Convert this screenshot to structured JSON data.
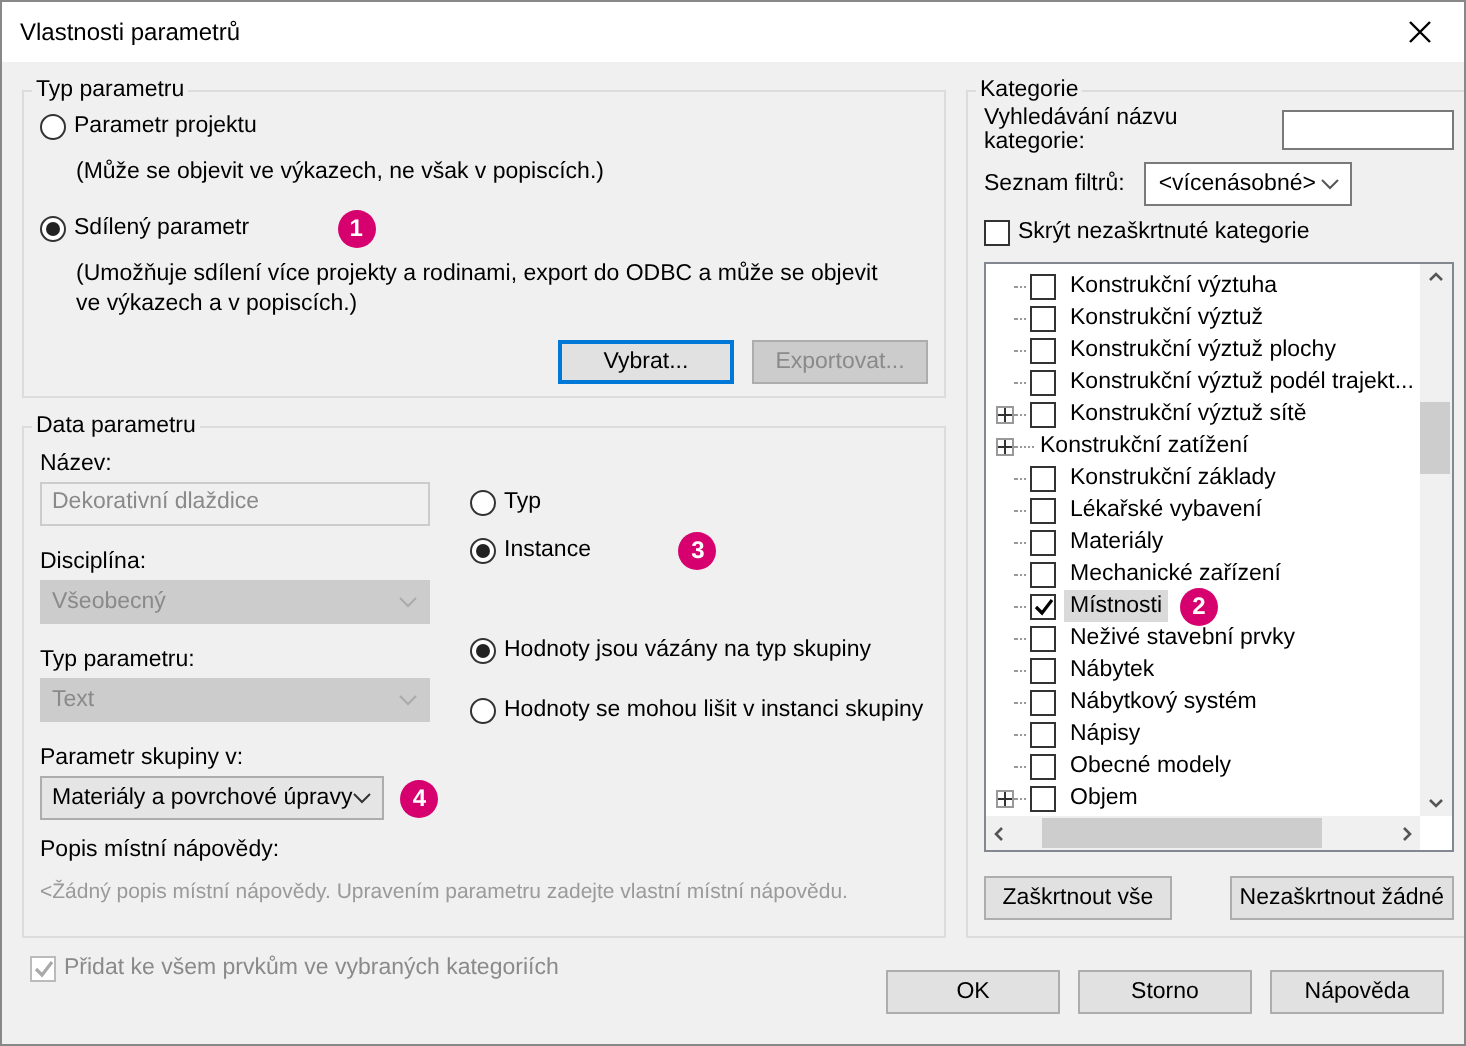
{
  "window": {
    "title": "Vlastnosti parametrů"
  },
  "parameter_type": {
    "title": "Typ parametru",
    "options": [
      {
        "label": "Parametr projektu",
        "description": "(Může se objevit ve výkazech, ne však v popiscích.)",
        "selected": false
      },
      {
        "label": "Sdílený parametr",
        "description": "(Umožňuje sdílení více projekty a rodinami, export do ODBC a může se objevit ve výkazech a v popiscích.)",
        "selected": true,
        "badge": "1"
      }
    ],
    "buttons": [
      {
        "label": "Vybrat...",
        "disabled": false,
        "focused": true
      },
      {
        "label": "Exportovat...",
        "disabled": true,
        "focused": false
      }
    ]
  },
  "parameter_data": {
    "title": "Data parametru",
    "name": {
      "label": "Název:",
      "value": "Dekorativní dlaždice",
      "disabled": true
    },
    "discipline": {
      "label": "Disciplína:",
      "value": "Všeobecný",
      "disabled": true
    },
    "type": {
      "label": "Typ parametru:",
      "value": "Text",
      "disabled": true
    },
    "group": {
      "label": "Parametr skupiny v:",
      "value": "Materiály a povrchové úpravy",
      "disabled": false,
      "badge": "4"
    },
    "tooltip": {
      "label": "Popis místní nápovědy:",
      "value": "<Žádný popis místní nápovědy. Upravením parametru zadejte vlastní místní nápovědu."
    },
    "scope_options": [
      {
        "label": "Typ",
        "selected": false
      },
      {
        "label": "Instance",
        "selected": true,
        "badge": "3"
      }
    ],
    "group_options": [
      {
        "label": "Hodnoty jsou vázány na typ skupiny",
        "selected": true
      },
      {
        "label": "Hodnoty se mohou lišit v instanci skupiny",
        "selected": false
      }
    ]
  },
  "categories": {
    "title": "Kategorie",
    "search": {
      "label": "Vyhledávání názvu kategorie:"
    },
    "filter": {
      "label": "Seznam filtrů:",
      "value": "<vícenásobné>"
    },
    "hide_unchecked": {
      "label": "Skrýt nezaškrtnuté kategorie",
      "checked": false
    },
    "items": [
      {
        "kind": "category",
        "label": "Konstrukční výztuha",
        "expandable": false,
        "checked": false,
        "selected": false
      },
      {
        "kind": "category",
        "label": "Konstrukční výztuž",
        "expandable": false,
        "checked": false,
        "selected": false
      },
      {
        "kind": "category",
        "label": "Konstrukční výztuž plochy",
        "expandable": false,
        "checked": false,
        "selected": false
      },
      {
        "kind": "category",
        "label": "Konstrukční výztuž podél trajekt...",
        "expandable": false,
        "checked": false,
        "selected": false
      },
      {
        "kind": "category",
        "label": "Konstrukční výztuž sítě",
        "expandable": true,
        "checked": false,
        "selected": false
      },
      {
        "kind": "group",
        "label": "Konstrukční zatížení",
        "expandable": true,
        "selected": false
      },
      {
        "kind": "category",
        "label": "Konstrukční základy",
        "expandable": false,
        "checked": false,
        "selected": false
      },
      {
        "kind": "category",
        "label": "Lékařské vybavení",
        "expandable": false,
        "checked": false,
        "selected": false
      },
      {
        "kind": "category",
        "label": "Materiály",
        "expandable": false,
        "checked": false,
        "selected": false
      },
      {
        "kind": "category",
        "label": "Mechanické zařízení",
        "expandable": false,
        "checked": false,
        "selected": false
      },
      {
        "kind": "category",
        "label": "Místnosti",
        "expandable": false,
        "checked": true,
        "selected": true,
        "badge": "2"
      },
      {
        "kind": "category",
        "label": "Neživé stavební prvky",
        "expandable": false,
        "checked": false,
        "selected": false
      },
      {
        "kind": "category",
        "label": "Nábytek",
        "expandable": false,
        "checked": false,
        "selected": false
      },
      {
        "kind": "category",
        "label": "Nábytkový systém",
        "expandable": false,
        "checked": false,
        "selected": false
      },
      {
        "kind": "category",
        "label": "Nápisy",
        "expandable": false,
        "checked": false,
        "selected": false
      },
      {
        "kind": "category",
        "label": "Obecné modely",
        "expandable": false,
        "checked": false,
        "selected": false
      },
      {
        "kind": "category",
        "label": "Objem",
        "expandable": true,
        "checked": false,
        "selected": false
      }
    ],
    "buttons": [
      "Zaškrtnout vše",
      "Nezaškrtnout žádné"
    ]
  },
  "footer": {
    "apply_all": {
      "label": "Přidat ke všem prvkům ve vybraných kategoriích",
      "checked": true,
      "disabled": true
    },
    "buttons": [
      "OK",
      "Storno",
      "Nápověda"
    ]
  }
}
